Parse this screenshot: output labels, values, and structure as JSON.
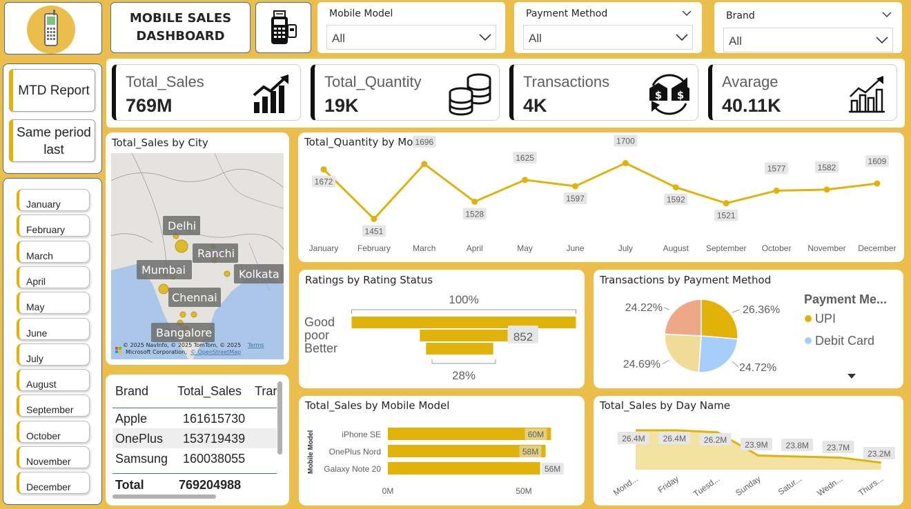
{
  "header": {
    "title_line1": "MOBILE SALES",
    "title_line2": "DASHBOARD",
    "logo_icon": "mobile-phone-icon",
    "pos_icon": "card-terminal-icon"
  },
  "slicers": {
    "mobile_model": {
      "label": "Mobile Model",
      "value": "All"
    },
    "payment_method": {
      "label": "Payment Method",
      "value": "All"
    },
    "brand": {
      "label": "Brand",
      "value": "All"
    }
  },
  "nav": {
    "mtd": "MTD Report",
    "same_period_1": "Same period",
    "same_period_2": "last"
  },
  "months": [
    "January",
    "February",
    "March",
    "April",
    "May",
    "June",
    "July",
    "August",
    "September",
    "October",
    "November",
    "December"
  ],
  "kpis": {
    "total_sales": {
      "label": "Total_Sales",
      "value": "769M"
    },
    "total_quantity": {
      "label": "Total_Quantity",
      "value": "19K"
    },
    "transactions": {
      "label": "Transactions",
      "value": "4K"
    },
    "average": {
      "label": "Avarage",
      "value": "40.11K"
    }
  },
  "map": {
    "title": "Total_Sales by City",
    "cities": [
      "Delhi",
      "Ranchi",
      "Mumbai",
      "Kolkata",
      "Chennai",
      "Bangalore"
    ],
    "credit1": "© 2025 NavInfo, © 2025 TomTom, © 2025",
    "credit2": "Microsoft Corporation,",
    "credit_link": "© OpenStreetMap",
    "terms": "Terms"
  },
  "colors": {
    "accent": "#E0B20A",
    "background": "#EBBE4C",
    "pie": [
      "#E0B20A",
      "#A7CDFA",
      "#F0DC97",
      "#EFA789"
    ]
  },
  "chart_data": [
    {
      "type": "line",
      "title": "Total_Quantity by Month",
      "categories": [
        "January",
        "February",
        "March",
        "April",
        "May",
        "June",
        "July",
        "August",
        "September",
        "October",
        "November",
        "December"
      ],
      "values": [
        1672,
        1451,
        1696,
        1528,
        1625,
        1597,
        1700,
        1592,
        1521,
        1577,
        1582,
        1609
      ]
    },
    {
      "type": "bar",
      "title": "Ratings by Rating Status",
      "categories": [
        "Good",
        "poor",
        "Better"
      ],
      "values": [
        3044,
        852,
        852
      ],
      "percent_labels": [
        "100%",
        "28%"
      ],
      "data_label": "852"
    },
    {
      "type": "pie",
      "title": "Transactions by Payment Method",
      "legend_title": "Payment Me...",
      "legend": [
        "UPI",
        "Debit Card"
      ],
      "values": [
        26.36,
        24.72,
        24.69,
        24.22
      ],
      "labels": [
        "26.36%",
        "24.72%",
        "24.69%",
        "24.22%"
      ]
    },
    {
      "type": "bar",
      "title": "Total_Sales by Mobile Model",
      "ylabel": "Mobile Model",
      "categories": [
        "iPhone SE",
        "OnePlus Nord",
        "Galaxy Note 20"
      ],
      "values": [
        60,
        58,
        56
      ],
      "labels": [
        "60M",
        "58M",
        "56M"
      ],
      "xticks": [
        "0M",
        "50M"
      ]
    },
    {
      "type": "area",
      "title": "Total_Sales by Day Name",
      "categories": [
        "Mond...",
        "Friday",
        "Tuesd...",
        "Sunday",
        "Satur...",
        "Wedn...",
        "Thurs..."
      ],
      "values": [
        26.4,
        26.4,
        26.2,
        23.9,
        23.8,
        23.7,
        23.2
      ],
      "labels": [
        "26.4M",
        "26.4M",
        "26.2M",
        "23.9M",
        "23.8M",
        "23.7M",
        "23.2M"
      ]
    },
    {
      "type": "table",
      "columns": [
        "Brand",
        "Total_Sales",
        "Trar"
      ],
      "rows": [
        [
          "Apple",
          "161615730"
        ],
        [
          "OnePlus",
          "153719439"
        ],
        [
          "Samsung",
          "160038055"
        ]
      ],
      "total": [
        "Total",
        "769204988"
      ]
    }
  ]
}
